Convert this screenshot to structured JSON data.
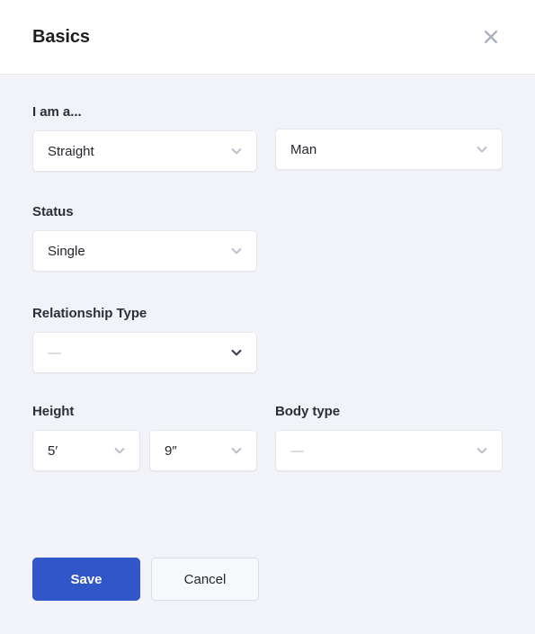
{
  "header": {
    "title": "Basics",
    "close_icon": "close-icon"
  },
  "form": {
    "orientation": {
      "label": "I am a...",
      "value": "Straight",
      "chevron_icon": "chevron-down-icon"
    },
    "gender": {
      "label": "",
      "value": "Man",
      "chevron_icon": "chevron-down-icon"
    },
    "status": {
      "label": "Status",
      "value": "Single",
      "chevron_icon": "chevron-down-icon"
    },
    "relationship_type": {
      "label": "Relationship Type",
      "value": "—",
      "chevron_icon": "chevron-down-icon"
    },
    "height": {
      "label": "Height",
      "feet_value": "5′",
      "inches_value": "9″",
      "chevron_icon": "chevron-down-icon"
    },
    "body_type": {
      "label": "Body type",
      "value": "—",
      "chevron_icon": "chevron-down-icon"
    }
  },
  "footer": {
    "save_label": "Save",
    "cancel_label": "Cancel"
  },
  "colors": {
    "primary": "#3056c8",
    "background": "#f2f3f8",
    "surface": "#ffffff",
    "text": "#22262e",
    "muted": "#b6bbc7",
    "border": "#e4e6ee"
  }
}
